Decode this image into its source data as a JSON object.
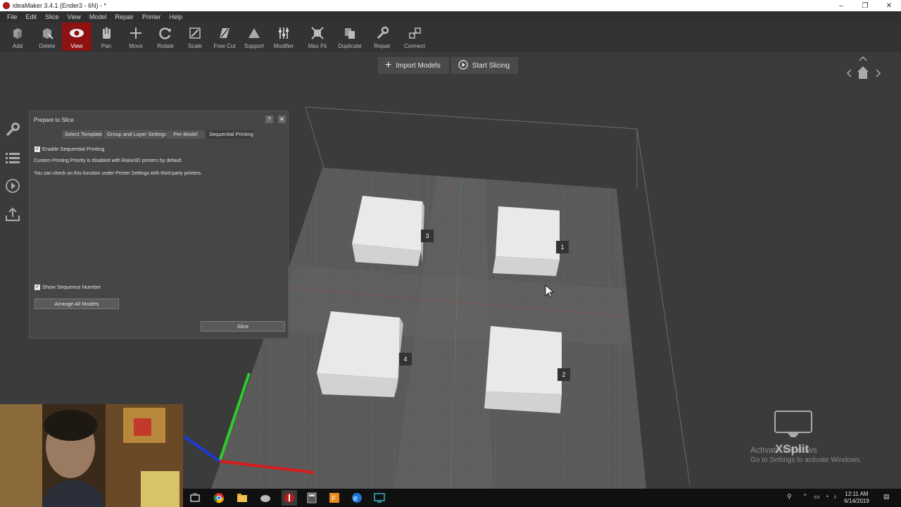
{
  "window": {
    "title": "ideaMaker 3.4.1 (Ender3 - 6N) - *",
    "controls": [
      "–",
      "❐",
      "✕"
    ]
  },
  "menu": [
    "File",
    "Edit",
    "Slice",
    "View",
    "Model",
    "Repair",
    "Printer",
    "Help"
  ],
  "toolbar": [
    {
      "label": "Add",
      "icon": "add-model-icon"
    },
    {
      "label": "Delete",
      "icon": "delete-icon"
    },
    {
      "label": "View",
      "icon": "eye-icon",
      "active": true
    },
    {
      "label": "Pan",
      "icon": "hand-icon"
    },
    {
      "label": "Move",
      "icon": "move-icon"
    },
    {
      "label": "Rotate",
      "icon": "rotate-icon"
    },
    {
      "label": "Scale",
      "icon": "scale-icon"
    },
    {
      "label": "Free Cut",
      "icon": "cut-icon"
    },
    {
      "label": "Support",
      "icon": "support-icon"
    },
    {
      "label": "Modifier",
      "icon": "modifier-icon"
    },
    {
      "label": "Max Fit",
      "icon": "max-fit-icon"
    },
    {
      "label": "Duplicate",
      "icon": "duplicate-icon"
    },
    {
      "label": "Repair",
      "icon": "wrench-icon"
    },
    {
      "label": "Connect",
      "icon": "connect-icon"
    }
  ],
  "top_buttons": {
    "import": "Import Models",
    "slice": "Start Slicing"
  },
  "dialog": {
    "title": "Prepare to Slice",
    "help": "?",
    "close": "✕",
    "tabs": [
      "Select Template",
      "Group and Layer Settings",
      "Per-Model",
      "Sequential Printing"
    ],
    "active_tab": "Sequential Printing",
    "enable_sequential": "Enable Sequential Printing",
    "note1": "Custom Printing Priority is disabled with Raise3D printers by default.",
    "note2": "You can check on this function under Printer Settings with third-party printers.",
    "show_sequence": "Show Sequence Number",
    "arrange_button": "Arrange All Models",
    "slice_button": "Slice"
  },
  "models": [
    {
      "seq": "3"
    },
    {
      "seq": "1"
    },
    {
      "seq": "4"
    },
    {
      "seq": "2"
    }
  ],
  "watermark": {
    "line1": "Activate Windows",
    "line2": "Go to Settings to activate Windows.",
    "brand": "XSplit"
  },
  "taskbar": {
    "time": "12:11 AM",
    "date": "6/14/2019"
  },
  "colors": {
    "accent": "#8f1212",
    "x_axis": "#d81c1c",
    "y_axis": "#2ecc2e",
    "z_axis": "#1c3bd8"
  }
}
